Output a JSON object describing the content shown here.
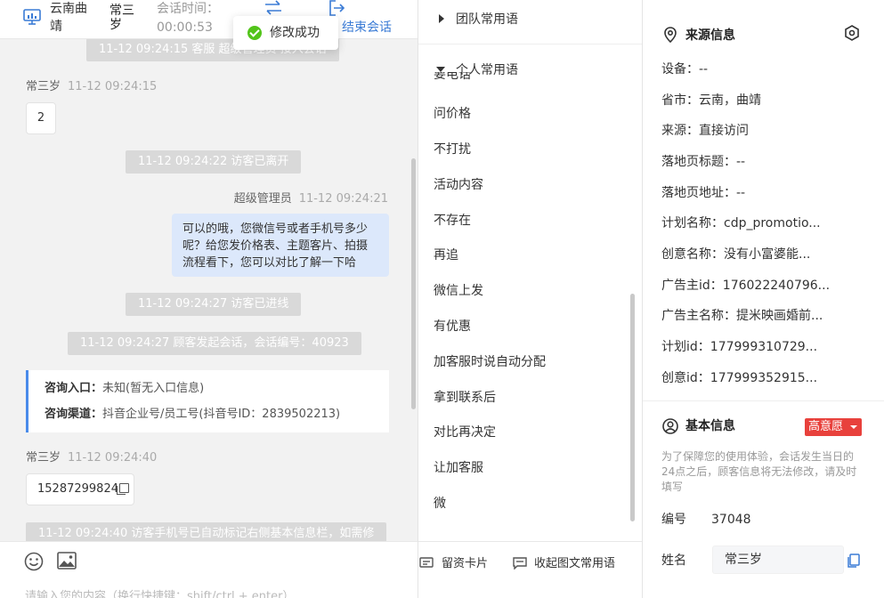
{
  "header": {
    "region": "云南曲靖",
    "visitor_name": "常三岁",
    "session_time_label": "会话时间：",
    "session_time_value": "00:00:53",
    "end_session_label": "结束会话"
  },
  "toast": {
    "message": "修改成功"
  },
  "messages": {
    "sys_top": "11-12 09:24:15 客服 超级管理员 接入会话",
    "visitor1": {
      "name": "常三岁",
      "time": "11-12 09:24:15",
      "text": "2"
    },
    "sys_left": "11-12 09:24:22 访客已离开",
    "agent1": {
      "name": "超级管理员",
      "time": "11-12 09:24:21",
      "line1": "可以的哦，您微信号或者手机号多少",
      "line2": "呢？给您发价格表、主题客片、拍摄",
      "line3": "流程看下，您可以对比了解一下哈"
    },
    "sys_online": "11-12 09:24:27 访客已进线",
    "sys_session": "11-12 09:24:27 顾客发起会话，会话编号：40923",
    "entry": {
      "entry_label": "咨询入口：",
      "entry_value": "未知(暂无入口信息)",
      "channel_label": "咨询渠道：",
      "channel_value": "抖音企业号/员工号(抖音号ID：2839502213)"
    },
    "visitor2": {
      "name": "常三岁",
      "time": "11-12 09:24:40",
      "text": "15287299824"
    },
    "sys_phone": "11-12 09:24:40 访客手机号已自动标记右侧基本信息栏，如需修"
  },
  "toolbar": {
    "card_label": "留资卡片",
    "collapse_label": "收起图文常用语",
    "input_placeholder": "请输入您的内容（换行快捷键：shift/ctrl + enter）"
  },
  "phrases": {
    "team_group": "团队常用语",
    "personal_group": "个人常用语",
    "partial_top": "要电话",
    "items": [
      "问价格",
      "不打扰",
      "活动内容",
      "不存在",
      "再追",
      "微信上发",
      "有优惠",
      "加客服时说自动分配",
      "拿到联系后",
      "对比再决定",
      "让加客服",
      "微"
    ]
  },
  "source_info": {
    "title": "来源信息",
    "fields": [
      {
        "k": "设备",
        "v": "--"
      },
      {
        "k": "省市",
        "v": "云南，曲靖"
      },
      {
        "k": "来源",
        "v": "直接访问"
      },
      {
        "k": "落地页标题",
        "v": "--"
      },
      {
        "k": "落地页地址",
        "v": "--"
      },
      {
        "k": "计划名称",
        "v": "cdp_promotio..."
      },
      {
        "k": "创意名称",
        "v": "没有小富婆能..."
      },
      {
        "k": "广告主id",
        "v": "176022240796..."
      },
      {
        "k": "广告主名称",
        "v": "提米映画婚前..."
      },
      {
        "k": "计划id",
        "v": "177999310729..."
      },
      {
        "k": "创意id",
        "v": "177999352915..."
      }
    ]
  },
  "basic_info": {
    "title": "基本信息",
    "intent_label": "高意愿",
    "notice": "为了保障您的使用体验，会话发生当日的24点之后，顾客信息将无法修改，请及时填写",
    "number_label": "编号",
    "number_value": "37048",
    "name_label": "姓名",
    "name_value": "常三岁"
  },
  "colors": {
    "accent_blue": "#3a7bd5",
    "agent_bubble": "#dce8fb",
    "intent_red": "#e8413c",
    "success_green": "#52c41a"
  }
}
